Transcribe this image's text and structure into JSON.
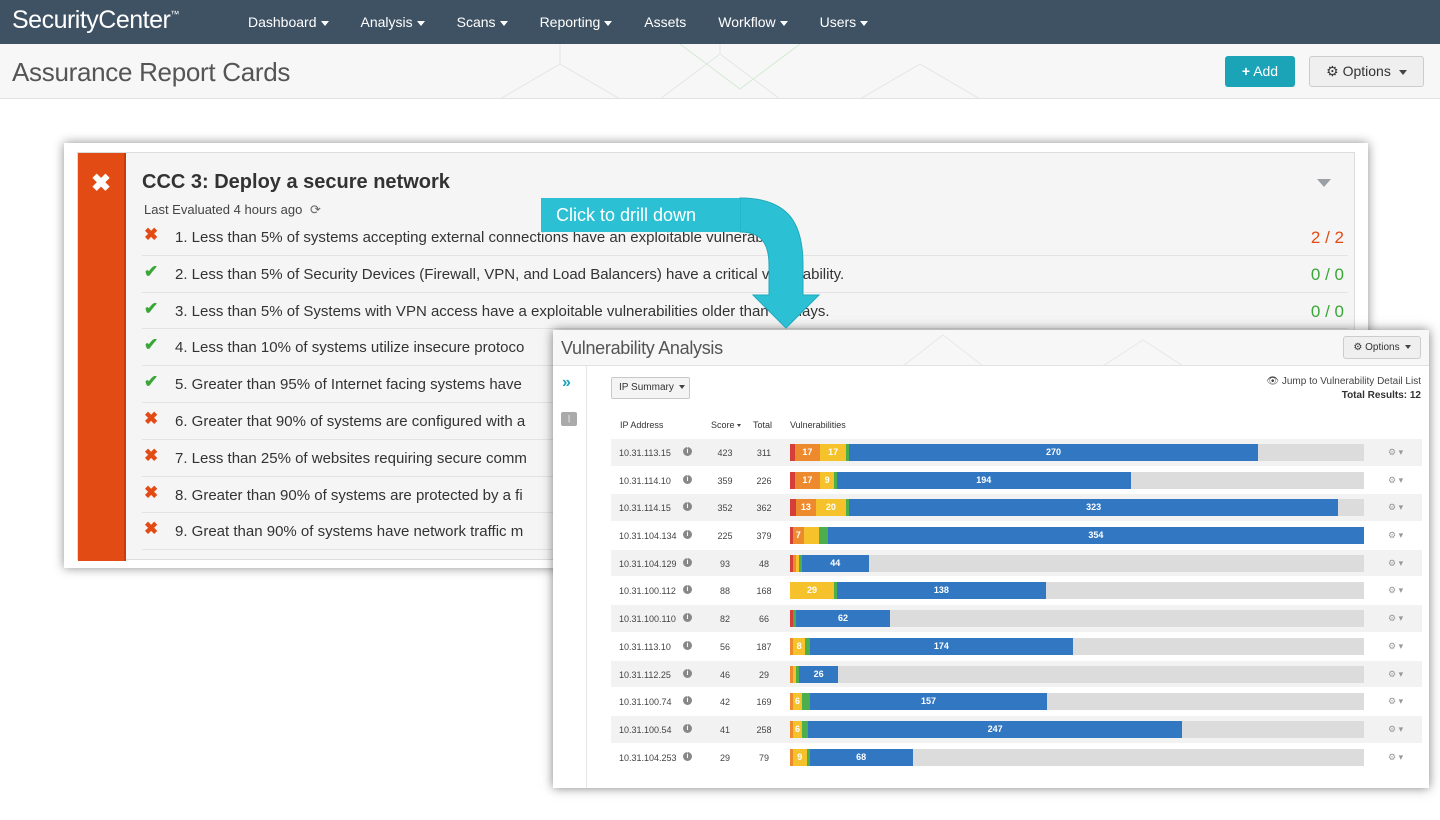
{
  "app": {
    "logo": "SecurityCenter",
    "logo_mark": "™",
    "nav": [
      {
        "label": "Dashboard",
        "dropdown": true
      },
      {
        "label": "Analysis",
        "dropdown": true
      },
      {
        "label": "Scans",
        "dropdown": true
      },
      {
        "label": "Reporting",
        "dropdown": true
      },
      {
        "label": "Assets",
        "dropdown": false
      },
      {
        "label": "Workflow",
        "dropdown": true
      },
      {
        "label": "Users",
        "dropdown": true
      }
    ]
  },
  "page": {
    "title": "Assurance Report Cards",
    "add_label": "Add",
    "options_label": "Options"
  },
  "card": {
    "title": "CCC 3: Deploy a secure network",
    "status": "fail",
    "last_evaluated_label": "Last Evaluated",
    "last_evaluated_value": "4 hours ago",
    "requirements": [
      {
        "text": "1. Less than 5% of systems accepting external connections have an exploitable vulnerability.",
        "status": "fail",
        "count": "2 / 2"
      },
      {
        "text": "2. Less than 5% of Security Devices (Firewall, VPN, and Load Balancers) have a critical vulnerability.",
        "status": "pass",
        "count": "0 / 0"
      },
      {
        "text": "3. Less than 5% of Systems with VPN access have a exploitable vulnerabilities older than 30 days.",
        "status": "pass",
        "count": "0 / 0"
      },
      {
        "text": "4. Less than 10% of systems utilize insecure protoco",
        "status": "pass",
        "count": ""
      },
      {
        "text": "5. Greater than 95% of Internet facing systems have",
        "status": "pass",
        "count": ""
      },
      {
        "text": "6. Greater that 90% of systems are configured with a",
        "status": "fail",
        "count": ""
      },
      {
        "text": "7. Less than 25% of websites requiring secure comm",
        "status": "fail",
        "count": ""
      },
      {
        "text": "8. Greater than 90% of systems are protected by a fi",
        "status": "fail",
        "count": ""
      },
      {
        "text": "9. Great than 90% of systems have network traffic m",
        "status": "fail",
        "count": ""
      }
    ]
  },
  "callout": {
    "label": "Click to drill down"
  },
  "vuln_panel": {
    "title": "Vulnerability Analysis",
    "options_label": "Options",
    "tool_select": "IP Summary",
    "jump_link": "Jump to Vulnerability Detail List",
    "total_results_label": "Total Results:",
    "total_results_value": "12",
    "columns": {
      "ip": "IP Address",
      "score": "Score",
      "total": "Total",
      "vulns": "Vulnerabilities"
    },
    "severity_colors": {
      "critical": "#d43f3a",
      "high": "#ee8a2e",
      "medium": "#f5c22b",
      "low": "#4cae4c",
      "info": "#3277c2"
    },
    "rows": [
      {
        "ip": "10.31.113.15",
        "score": "423",
        "total": "311",
        "segs": [
          {
            "sev": "critical",
            "n": 3,
            "label": ""
          },
          {
            "sev": "high",
            "n": 17,
            "label": "17"
          },
          {
            "sev": "medium",
            "n": 17,
            "label": "17"
          },
          {
            "sev": "low",
            "n": 1,
            "label": ""
          },
          {
            "sev": "info",
            "n": 270,
            "label": "270"
          }
        ]
      },
      {
        "ip": "10.31.114.10",
        "score": "359",
        "total": "226",
        "segs": [
          {
            "sev": "critical",
            "n": 3,
            "label": ""
          },
          {
            "sev": "high",
            "n": 17,
            "label": "17"
          },
          {
            "sev": "medium",
            "n": 9,
            "label": "9"
          },
          {
            "sev": "low",
            "n": 1,
            "label": ""
          },
          {
            "sev": "info",
            "n": 194,
            "label": "194"
          }
        ]
      },
      {
        "ip": "10.31.114.15",
        "score": "352",
        "total": "362",
        "segs": [
          {
            "sev": "critical",
            "n": 4,
            "label": ""
          },
          {
            "sev": "high",
            "n": 13,
            "label": "13"
          },
          {
            "sev": "medium",
            "n": 20,
            "label": "20"
          },
          {
            "sev": "low",
            "n": 2,
            "label": ""
          },
          {
            "sev": "info",
            "n": 323,
            "label": "323"
          }
        ]
      },
      {
        "ip": "10.31.104.134",
        "score": "225",
        "total": "379",
        "segs": [
          {
            "sev": "critical",
            "n": 2,
            "label": ""
          },
          {
            "sev": "high",
            "n": 7,
            "label": "7"
          },
          {
            "sev": "medium",
            "n": 10,
            "label": ""
          },
          {
            "sev": "low",
            "n": 6,
            "label": ""
          },
          {
            "sev": "info",
            "n": 354,
            "label": "354"
          }
        ]
      },
      {
        "ip": "10.31.104.129",
        "score": "93",
        "total": "48",
        "segs": [
          {
            "sev": "critical",
            "n": 1,
            "label": ""
          },
          {
            "sev": "high",
            "n": 1,
            "label": ""
          },
          {
            "sev": "medium",
            "n": 1,
            "label": ""
          },
          {
            "sev": "low",
            "n": 1,
            "label": ""
          },
          {
            "sev": "info",
            "n": 44,
            "label": "44"
          }
        ]
      },
      {
        "ip": "10.31.100.112",
        "score": "88",
        "total": "168",
        "segs": [
          {
            "sev": "medium",
            "n": 29,
            "label": "29"
          },
          {
            "sev": "low",
            "n": 1,
            "label": ""
          },
          {
            "sev": "info",
            "n": 138,
            "label": "138"
          }
        ]
      },
      {
        "ip": "10.31.100.110",
        "score": "82",
        "total": "66",
        "segs": [
          {
            "sev": "critical",
            "n": 1,
            "label": ""
          },
          {
            "sev": "low",
            "n": 2,
            "label": ""
          },
          {
            "sev": "info",
            "n": 62,
            "label": "62"
          }
        ]
      },
      {
        "ip": "10.31.113.10",
        "score": "56",
        "total": "187",
        "segs": [
          {
            "sev": "high",
            "n": 2,
            "label": ""
          },
          {
            "sev": "medium",
            "n": 8,
            "label": "8"
          },
          {
            "sev": "low",
            "n": 3,
            "label": ""
          },
          {
            "sev": "info",
            "n": 174,
            "label": "174"
          }
        ]
      },
      {
        "ip": "10.31.112.25",
        "score": "46",
        "total": "29",
        "segs": [
          {
            "sev": "high",
            "n": 1,
            "label": ""
          },
          {
            "sev": "medium",
            "n": 1,
            "label": ""
          },
          {
            "sev": "low",
            "n": 1,
            "label": ""
          },
          {
            "sev": "info",
            "n": 26,
            "label": "26"
          }
        ]
      },
      {
        "ip": "10.31.100.74",
        "score": "42",
        "total": "169",
        "segs": [
          {
            "sev": "high",
            "n": 1,
            "label": ""
          },
          {
            "sev": "medium",
            "n": 6,
            "label": "6"
          },
          {
            "sev": "low",
            "n": 5,
            "label": ""
          },
          {
            "sev": "info",
            "n": 157,
            "label": "157"
          }
        ]
      },
      {
        "ip": "10.31.100.54",
        "score": "41",
        "total": "258",
        "segs": [
          {
            "sev": "high",
            "n": 1,
            "label": ""
          },
          {
            "sev": "medium",
            "n": 6,
            "label": "6"
          },
          {
            "sev": "low",
            "n": 4,
            "label": ""
          },
          {
            "sev": "info",
            "n": 247,
            "label": "247"
          }
        ]
      },
      {
        "ip": "10.31.104.253",
        "score": "29",
        "total": "79",
        "segs": [
          {
            "sev": "high",
            "n": 1,
            "label": ""
          },
          {
            "sev": "medium",
            "n": 9,
            "label": "9"
          },
          {
            "sev": "low",
            "n": 1,
            "label": ""
          },
          {
            "sev": "info",
            "n": 68,
            "label": "68"
          }
        ]
      }
    ]
  }
}
